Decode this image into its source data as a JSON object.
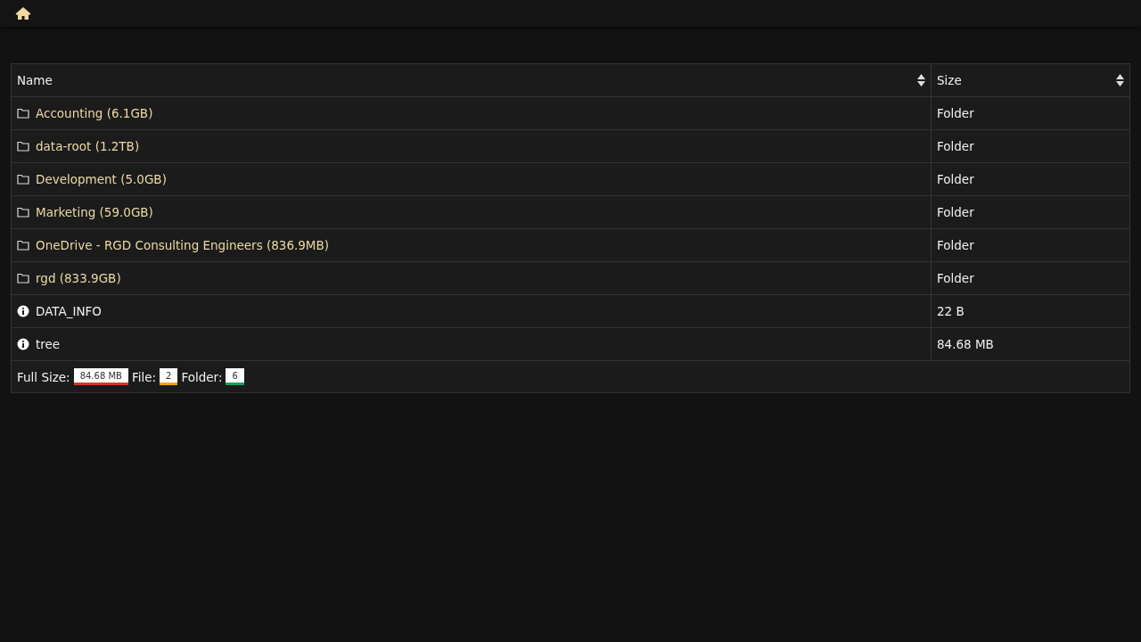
{
  "table": {
    "columns": [
      "Name",
      "Size"
    ],
    "rows": [
      {
        "kind": "folder",
        "name": "Accounting (6.1GB)",
        "size": "Folder"
      },
      {
        "kind": "folder",
        "name": "data-root (1.2TB)",
        "size": "Folder"
      },
      {
        "kind": "folder",
        "name": "Development (5.0GB)",
        "size": "Folder"
      },
      {
        "kind": "folder",
        "name": "Marketing (59.0GB)",
        "size": "Folder"
      },
      {
        "kind": "folder",
        "name": "OneDrive - RGD Consulting Engineers (836.9MB)",
        "size": "Folder"
      },
      {
        "kind": "folder",
        "name": "rgd (833.9GB)",
        "size": "Folder"
      },
      {
        "kind": "file",
        "name": "DATA_INFO",
        "size": "22 B"
      },
      {
        "kind": "file",
        "name": "tree",
        "size": "84.68 MB"
      }
    ],
    "summary": [
      {
        "label": "Full Size:",
        "value": "84.68 MB",
        "color": "#d9381e"
      },
      {
        "label": "File:",
        "value": "2",
        "color": "#f0a30a"
      },
      {
        "label": "Folder:",
        "value": "6",
        "color": "#1e9e5a"
      }
    ]
  }
}
